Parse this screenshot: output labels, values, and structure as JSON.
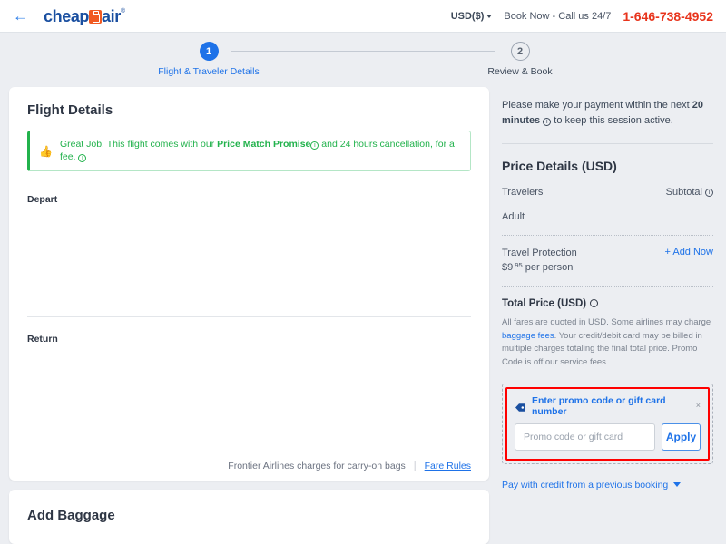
{
  "header": {
    "back_icon": "back-arrow-icon",
    "logo_part1": "cheap",
    "logo_part2": "air",
    "logo_reg": "®",
    "currency": "USD($)",
    "call_text": "Book Now - Call us 24/7",
    "phone": "1-646-738-4952"
  },
  "stepper": {
    "steps": [
      {
        "number": "1",
        "label": "Flight & Traveler Details",
        "state": "active"
      },
      {
        "number": "2",
        "label": "Review & Book",
        "state": "inactive"
      }
    ]
  },
  "flight_details": {
    "title": "Flight Details",
    "banner": {
      "icon": "thumbs-up-icon",
      "text_before": "Great Job! This flight comes with our ",
      "bold_text": "Price Match Promise",
      "text_after": " and 24 hours cancellation, for a fee."
    },
    "depart_label": "Depart",
    "return_label": "Return",
    "footer_note": "Frontier Airlines charges for carry-on bags",
    "fare_rules": "Fare Rules"
  },
  "baggage": {
    "title": "Add Baggage"
  },
  "sidebar": {
    "session_text_before": "Please make your payment within the next ",
    "session_bold": "20 minutes",
    "session_text_after": " to keep this session active.",
    "price_title": "Price Details (USD)",
    "travelers_label": "Travelers",
    "subtotal_label": "Subtotal",
    "adult_label": "Adult",
    "protection_name": "Travel Protection",
    "protection_currency": "$9",
    "protection_cents": ".95",
    "protection_unit": " per person",
    "add_now": "+ Add Now",
    "total_title": "Total Price (USD)",
    "disclaimer_part1": "All fares are quoted in USD. Some airlines may charge ",
    "disclaimer_link": "baggage fees",
    "disclaimer_part2": ". Your credit/debit card may be billed in multiple charges totaling the final total price. Promo Code is off our service fees.",
    "promo": {
      "icon": "tag-icon",
      "heading": "Enter promo code or gift card number",
      "close": "×",
      "input_value": "",
      "input_placeholder": "Promo code or gift card",
      "apply_label": "Apply"
    },
    "credit_link": "Pay with credit from a previous booking"
  },
  "colors": {
    "brand_blue": "#1a4fa0",
    "accent_orange": "#f15a22",
    "link_blue": "#1e72e8",
    "phone_red": "#e8341c",
    "success_green": "#22b24c",
    "highlight_red": "#ff0000"
  }
}
